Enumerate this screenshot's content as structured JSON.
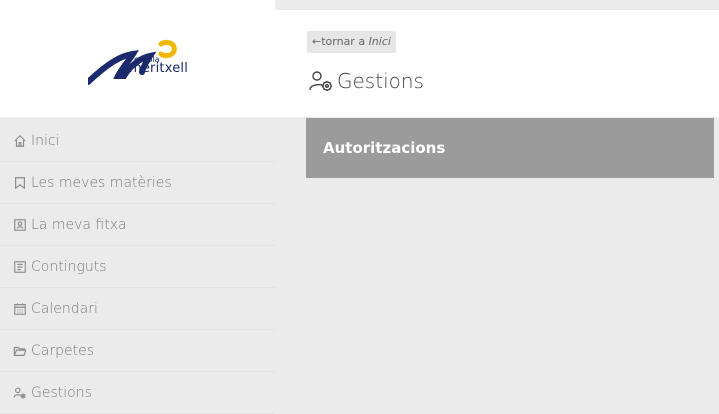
{
  "logo": {
    "small": "escola",
    "big": "meritxell"
  },
  "sidebar": {
    "items": [
      {
        "label": "Inici",
        "icon": "home-icon"
      },
      {
        "label": "Les meves matèries",
        "icon": "bookmark-icon"
      },
      {
        "label": "La meva fitxa",
        "icon": "id-card-icon"
      },
      {
        "label": "Continguts",
        "icon": "document-icon"
      },
      {
        "label": "Calendari",
        "icon": "calendar-icon"
      },
      {
        "label": "Carpetes",
        "icon": "folder-icon"
      },
      {
        "label": "Gestions",
        "icon": "user-gear-icon"
      }
    ]
  },
  "header": {
    "back_arrow": "←",
    "back_text": "tornar a ",
    "back_target": "Inici",
    "title": "Gestions"
  },
  "main": {
    "cards": [
      {
        "label": "Autoritzacions"
      }
    ]
  },
  "colors": {
    "background": "#ebebeb",
    "card": "#9b9b9b",
    "logo_blue": "#1a2a6c",
    "logo_yellow": "#f2b705"
  }
}
